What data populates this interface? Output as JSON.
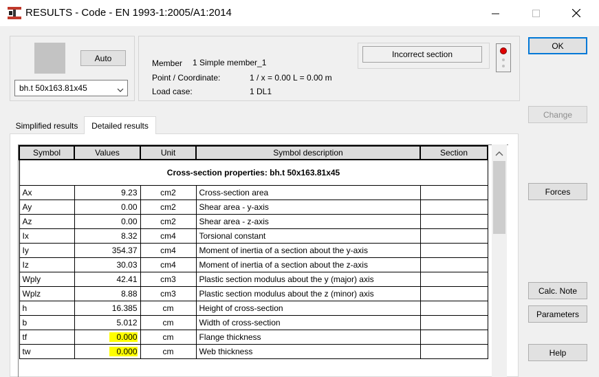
{
  "window": {
    "title": "RESULTS - Code - EN 1993-1:2005/A1:2014",
    "min_icon": "minimize-icon",
    "max_icon": "maximize-icon",
    "close_icon": "close-icon"
  },
  "section_panel": {
    "auto_button": "Auto",
    "section_select": "bh.t 50x163.81x45"
  },
  "info": {
    "member_label": "Member",
    "member_value": "1  Simple member_1",
    "point_label": "Point / Coordinate:",
    "point_value": "1 / x = 0.00 L = 0.00 m",
    "loadcase_label": "Load case:",
    "loadcase_value": "1 DL1",
    "status_text": "Incorrect section",
    "status_color": "#e00000"
  },
  "tabs": [
    {
      "label": "Simplified results"
    },
    {
      "label": "Detailed results"
    }
  ],
  "table": {
    "headers": [
      "Symbol",
      "Values",
      "Unit",
      "Symbol description",
      "Section"
    ],
    "section_title": "Cross-section properties: bh.t 50x163.81x45",
    "rows": [
      {
        "symbol": "Ax",
        "value": "9.23",
        "unit": "cm2",
        "desc": "Cross-section area"
      },
      {
        "symbol": "Ay",
        "value": "0.00",
        "unit": "cm2",
        "desc": "Shear area - y-axis"
      },
      {
        "symbol": "Az",
        "value": "0.00",
        "unit": "cm2",
        "desc": "Shear area - z-axis"
      },
      {
        "symbol": "Ix",
        "value": "8.32",
        "unit": "cm4",
        "desc": "Torsional constant"
      },
      {
        "symbol": "Iy",
        "value": "354.37",
        "unit": "cm4",
        "desc": "Moment of inertia of a section about the y-axis"
      },
      {
        "symbol": "Iz",
        "value": "30.03",
        "unit": "cm4",
        "desc": "Moment of inertia of a section about the z-axis"
      },
      {
        "symbol": "Wply",
        "value": "42.41",
        "unit": "cm3",
        "desc": "Plastic section modulus about the y (major) axis"
      },
      {
        "symbol": "Wplz",
        "value": "8.88",
        "unit": "cm3",
        "desc": "Plastic section modulus about the z (minor) axis"
      },
      {
        "symbol": "h",
        "value": "16.385",
        "unit": "cm",
        "desc": "Height of cross-section"
      },
      {
        "symbol": "b",
        "value": "5.012",
        "unit": "cm",
        "desc": "Width of cross-section"
      },
      {
        "symbol": "tf",
        "value": "0.000",
        "unit": "cm",
        "desc": "Flange thickness",
        "highlight": true
      },
      {
        "symbol": "tw",
        "value": "0.000",
        "unit": "cm",
        "desc": "Web thickness",
        "highlight": true
      }
    ],
    "highlight_color": "#ffff00"
  },
  "buttons": {
    "ok": "OK",
    "change": "Change",
    "forces": "Forces",
    "calc_note": "Calc. Note",
    "parameters": "Parameters",
    "help": "Help"
  }
}
